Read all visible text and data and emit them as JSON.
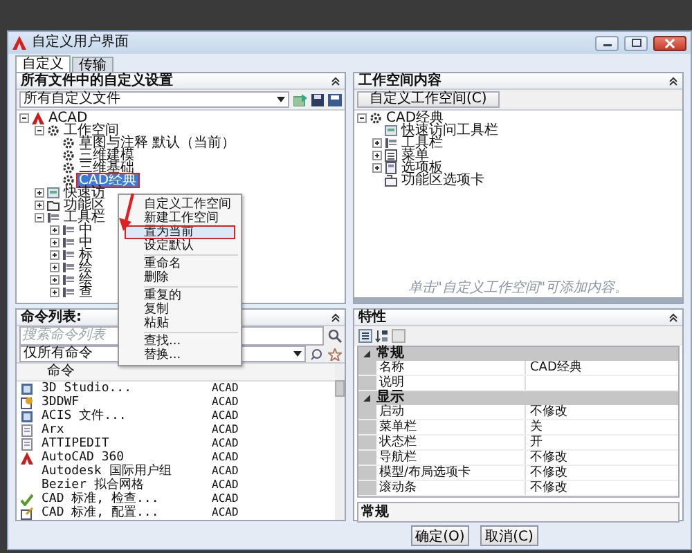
{
  "window": {
    "title": "自定义用户界面"
  },
  "tabs": [
    {
      "label": "自定义",
      "selected": true
    },
    {
      "label": "传输",
      "selected": false
    }
  ],
  "customizations": {
    "title": "所有文件中的自定义设置",
    "file_filter": "所有自定义文件",
    "tree": [
      {
        "label": "ACAD",
        "kind": "acad",
        "selected": false,
        "expanded": true,
        "children": [
          {
            "label": "工作空间",
            "kind": "workspace",
            "selected": false,
            "expanded": true,
            "children": [
              {
                "label": "草图与注释 默认（当前）",
                "kind": "gear",
                "selected": false
              },
              {
                "label": "三维建模",
                "kind": "gear",
                "selected": false
              },
              {
                "label": "三维基础",
                "kind": "gear",
                "selected": false
              },
              {
                "label": "CAD经典",
                "kind": "gear",
                "selected": true
              }
            ]
          },
          {
            "label": "快速访",
            "kind": "quick",
            "selected": false,
            "expanded": false
          },
          {
            "label": "功能区",
            "kind": "folder",
            "selected": false,
            "expanded": false
          },
          {
            "label": "工具栏",
            "kind": "toolbar",
            "selected": false,
            "expanded": true,
            "children": [
              {
                "label": "中",
                "kind": "toolbar",
                "selected": false,
                "expanded": false
              },
              {
                "label": "中",
                "kind": "toolbar",
                "selected": false,
                "expanded": false
              },
              {
                "label": "标",
                "kind": "toolbar",
                "selected": false,
                "expanded": false
              },
              {
                "label": "绘",
                "kind": "toolbar",
                "selected": false,
                "expanded": false
              },
              {
                "label": "绘",
                "kind": "toolbar",
                "selected": false,
                "expanded": false
              },
              {
                "label": "查",
                "kind": "toolbar",
                "selected": false,
                "expanded": false
              }
            ]
          }
        ]
      }
    ]
  },
  "context_menu": [
    {
      "kind": "item",
      "label": "自定义工作空间",
      "selected": false
    },
    {
      "kind": "item",
      "label": "新建工作空间",
      "selected": false
    },
    {
      "kind": "item",
      "label": "置为当前",
      "selected": true
    },
    {
      "kind": "item",
      "label": "设定默认",
      "selected": false
    },
    {
      "kind": "separator"
    },
    {
      "kind": "item",
      "label": "重命名",
      "selected": false
    },
    {
      "kind": "item",
      "label": "删除",
      "selected": false
    },
    {
      "kind": "separator"
    },
    {
      "kind": "item",
      "label": "重复的",
      "selected": false
    },
    {
      "kind": "item",
      "label": "复制",
      "selected": false
    },
    {
      "kind": "item",
      "label": "粘贴",
      "selected": false
    },
    {
      "kind": "separator"
    },
    {
      "kind": "item",
      "label": "查找...",
      "selected": false
    },
    {
      "kind": "item",
      "label": "替换...",
      "selected": false
    }
  ],
  "command_list": {
    "title": "命令列表:",
    "search": {
      "placeholder": "搜索命令列表"
    },
    "filter": "仅所有命令",
    "columns": [
      "命令"
    ],
    "rows": [
      {
        "name": "3D Studio...",
        "source": "ACAD",
        "kind": "dialog"
      },
      {
        "name": "3DDWF",
        "source": "ACAD",
        "kind": "plugin"
      },
      {
        "name": "ACIS 文件...",
        "source": "ACAD",
        "kind": "dialog"
      },
      {
        "name": "Arx",
        "source": "ACAD",
        "kind": "page"
      },
      {
        "name": "ATTIPEDIT",
        "source": "ACAD",
        "kind": "page"
      },
      {
        "name": "AutoCAD 360",
        "source": "ACAD",
        "kind": "acad"
      },
      {
        "name": "Autodesk 国际用户组",
        "source": "ACAD",
        "kind": "plain"
      },
      {
        "name": "Bezier 拟合网格",
        "source": "ACAD",
        "kind": "plain"
      },
      {
        "name": "CAD 标准, 检查...",
        "source": "ACAD",
        "kind": "check"
      },
      {
        "name": "CAD 标准, 配置...",
        "source": "ACAD",
        "kind": "config"
      }
    ]
  },
  "workspace_contents": {
    "title": "工作空间内容",
    "button": "自定义工作空间(C)",
    "tree": [
      {
        "label": "CAD经典",
        "kind": "gear",
        "selected": false,
        "expanded": true,
        "children": [
          {
            "label": "快速访问工具栏",
            "kind": "quick",
            "selected": false
          },
          {
            "label": "工具栏",
            "kind": "toolbar",
            "selected": false,
            "expanded": false
          },
          {
            "label": "菜单",
            "kind": "menu",
            "selected": false,
            "expanded": false
          },
          {
            "label": "选项板",
            "kind": "palette",
            "selected": false,
            "expanded": false
          },
          {
            "label": "功能区选项卡",
            "kind": "ribbon",
            "selected": false
          }
        ]
      }
    ],
    "hint": "单击\"自定义工作空间\"可添加内容。"
  },
  "properties": {
    "title": "特性",
    "groups": [
      {
        "name": "常规",
        "expanded": true,
        "rows": [
          {
            "name": "名称",
            "value": "CAD经典"
          },
          {
            "name": "说明",
            "value": ""
          }
        ]
      },
      {
        "name": "显示",
        "expanded": true,
        "rows": [
          {
            "name": "启动",
            "value": "不修改"
          },
          {
            "name": "菜单栏",
            "value": "关"
          },
          {
            "name": "状态栏",
            "value": "开"
          },
          {
            "name": "导航栏",
            "value": "不修改"
          },
          {
            "name": "模型/布局选项卡",
            "value": "不修改"
          },
          {
            "name": "滚动条",
            "value": "不修改"
          }
        ]
      }
    ],
    "description": "常规"
  },
  "buttons": [
    "确定(O)",
    "取消(C)"
  ]
}
